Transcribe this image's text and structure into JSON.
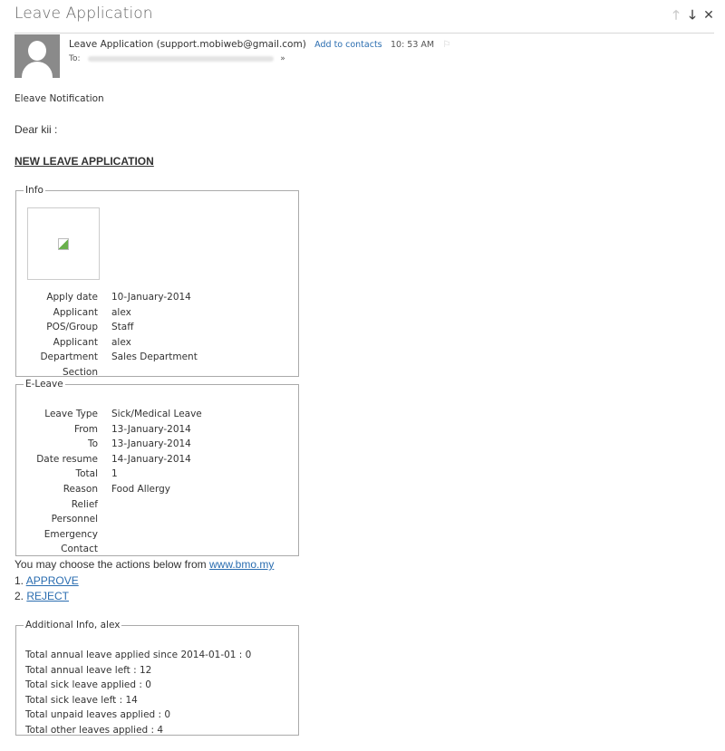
{
  "window": {
    "title": "Leave Application",
    "nav": {
      "prev_icon": "arrow-up-icon",
      "next_icon": "arrow-down-icon",
      "close_icon": "close-icon",
      "prev_glyph": "🡑",
      "next_glyph": "🡓",
      "close_glyph": "✕"
    }
  },
  "message": {
    "sender_name": "Leave Application",
    "sender_email": "(support.mobiweb@gmail.com)",
    "add_contacts_label": "Add to contacts",
    "time": "10: 53 AM",
    "flag_glyph": "⚐",
    "to_label": "To:",
    "expand_glyph": "»"
  },
  "body": {
    "notification": "Eleave Notification",
    "greeting": "Dear kii :",
    "heading": "NEW LEAVE APPLICATION",
    "info": {
      "legend": "Info",
      "rows": [
        {
          "label": "Apply date",
          "value": "10-January-2014"
        },
        {
          "label": "Applicant",
          "value": "alex"
        },
        {
          "label": "POS/Group",
          "value": "Staff"
        },
        {
          "label": "Applicant",
          "value": "alex"
        },
        {
          "label": "Department",
          "value": "Sales Department"
        },
        {
          "label": "Section",
          "value": ""
        }
      ]
    },
    "eleave": {
      "legend": "E-Leave",
      "rows": [
        {
          "label": "Leave Type",
          "value": "Sick/Medical Leave"
        },
        {
          "label": "From",
          "value": "13-January-2014"
        },
        {
          "label": "To",
          "value": "13-January-2014"
        },
        {
          "label": "Date resume",
          "value": "14-January-2014"
        },
        {
          "label": "Total",
          "value": "1"
        },
        {
          "label": "Reason",
          "value": "Food Allergy"
        },
        {
          "label": "Relief",
          "value": ""
        },
        {
          "label": "Personnel",
          "value": ""
        },
        {
          "label": "Emergency",
          "value": ""
        },
        {
          "label": "Contact",
          "value": ""
        }
      ]
    },
    "actions": {
      "intro": "You may choose the actions below from ",
      "site_link": "www.bmo.my",
      "items": [
        {
          "num": "1. ",
          "label": "APPROVE"
        },
        {
          "num": "2. ",
          "label": "REJECT"
        }
      ]
    },
    "additional": {
      "legend": "Additional Info, alex",
      "lines": [
        "Total annual leave applied since 2014-01-01 : 0",
        "Total annual leave left : 12",
        "Total sick leave applied : 0",
        "Total sick leave left : 14",
        "Total unpaid leaves applied : 0",
        "Total other leaves applied : 4"
      ]
    }
  }
}
